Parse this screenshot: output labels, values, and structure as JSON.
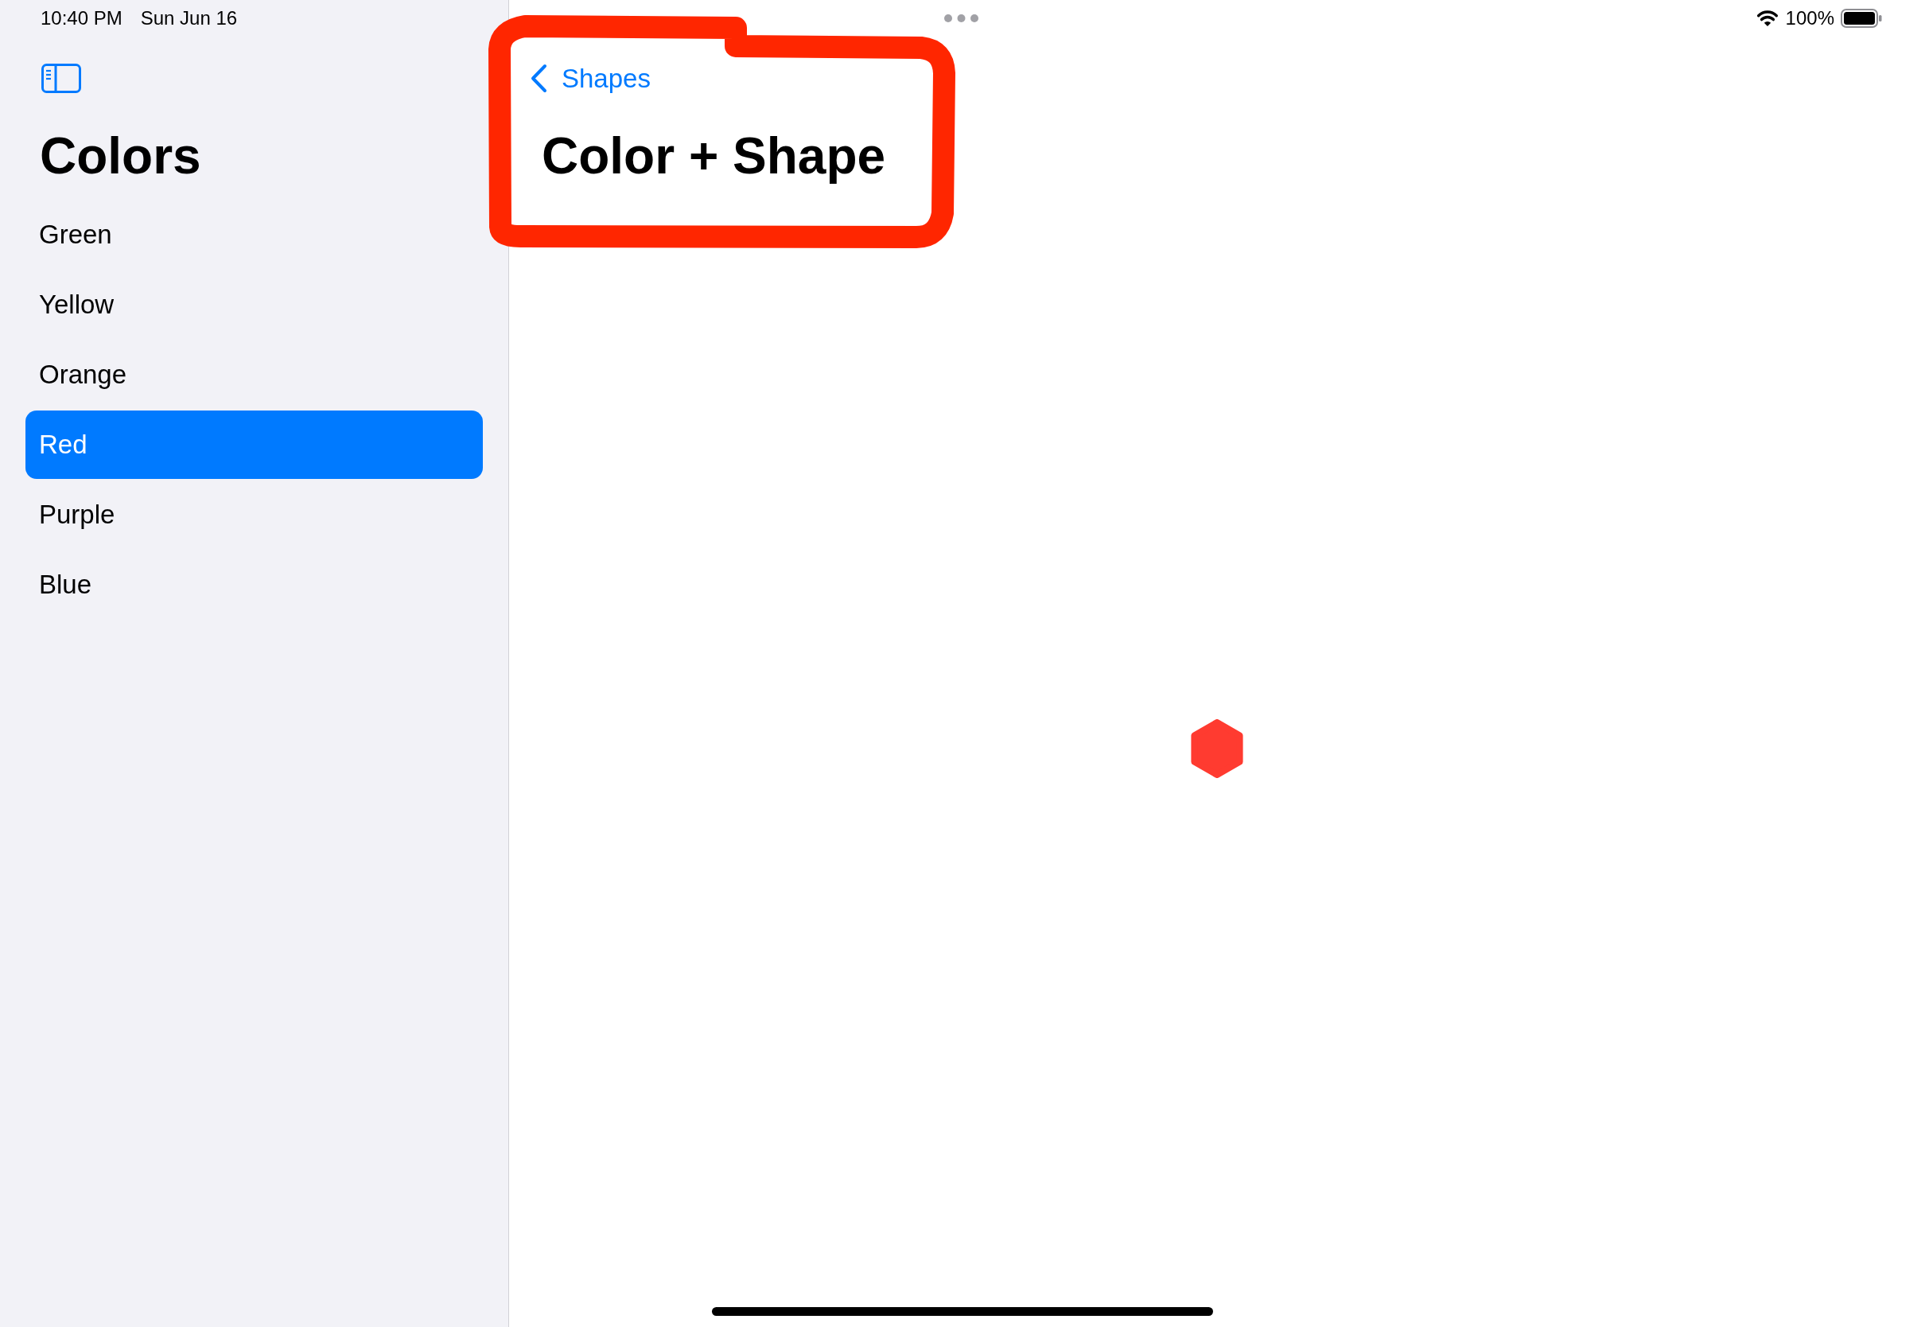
{
  "status_bar": {
    "time": "10:40 PM",
    "date": "Sun Jun 16",
    "battery": "100%"
  },
  "sidebar": {
    "title": "Colors",
    "items": [
      {
        "label": "Green",
        "selected": false
      },
      {
        "label": "Yellow",
        "selected": false
      },
      {
        "label": "Orange",
        "selected": false
      },
      {
        "label": "Red",
        "selected": true
      },
      {
        "label": "Purple",
        "selected": false
      },
      {
        "label": "Blue",
        "selected": false
      }
    ]
  },
  "detail": {
    "back_button": "Shapes",
    "title": "Color + Shape",
    "shape": {
      "kind": "hexagon"
    }
  },
  "annotation": {
    "kind": "freehand_outline"
  }
}
